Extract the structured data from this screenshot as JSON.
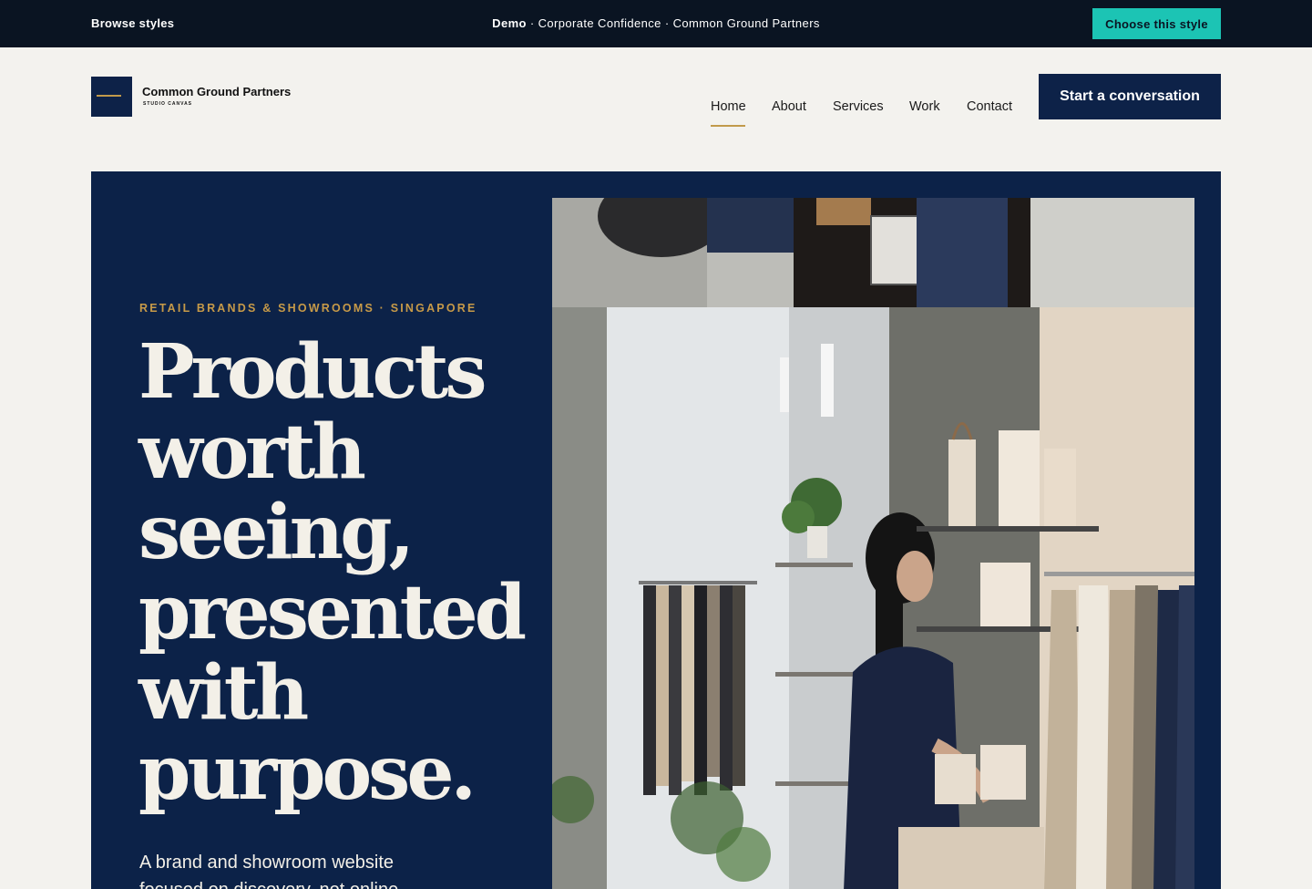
{
  "topbar": {
    "browse_label": "Browse styles",
    "demo_prefix": "Demo",
    "demo_text": " · Corporate Confidence · Common Ground Partners",
    "choose_label": "Choose this style",
    "accent_color": "#1cc4b4"
  },
  "brand": {
    "name": "Common Ground Partners",
    "tagline": "STUDIO CANVAS",
    "navy": "#0d2248",
    "gold": "#c19a4b"
  },
  "nav": {
    "items": [
      {
        "label": "Home",
        "active": true
      },
      {
        "label": "About"
      },
      {
        "label": "Services"
      },
      {
        "label": "Work"
      },
      {
        "label": "Contact"
      }
    ],
    "cta_label": "Start a conversation"
  },
  "hero": {
    "eyebrow": "RETAIL BRANDS & SHOWROOMS · SINGAPORE",
    "headline_lines": [
      "Products",
      "worth",
      "seeing,",
      "presented",
      "with",
      "purpose."
    ],
    "lede": "A brand and showroom website focused on discovery, not online",
    "image_alt": "Woman arranging products on shelves in a clothing showroom"
  }
}
